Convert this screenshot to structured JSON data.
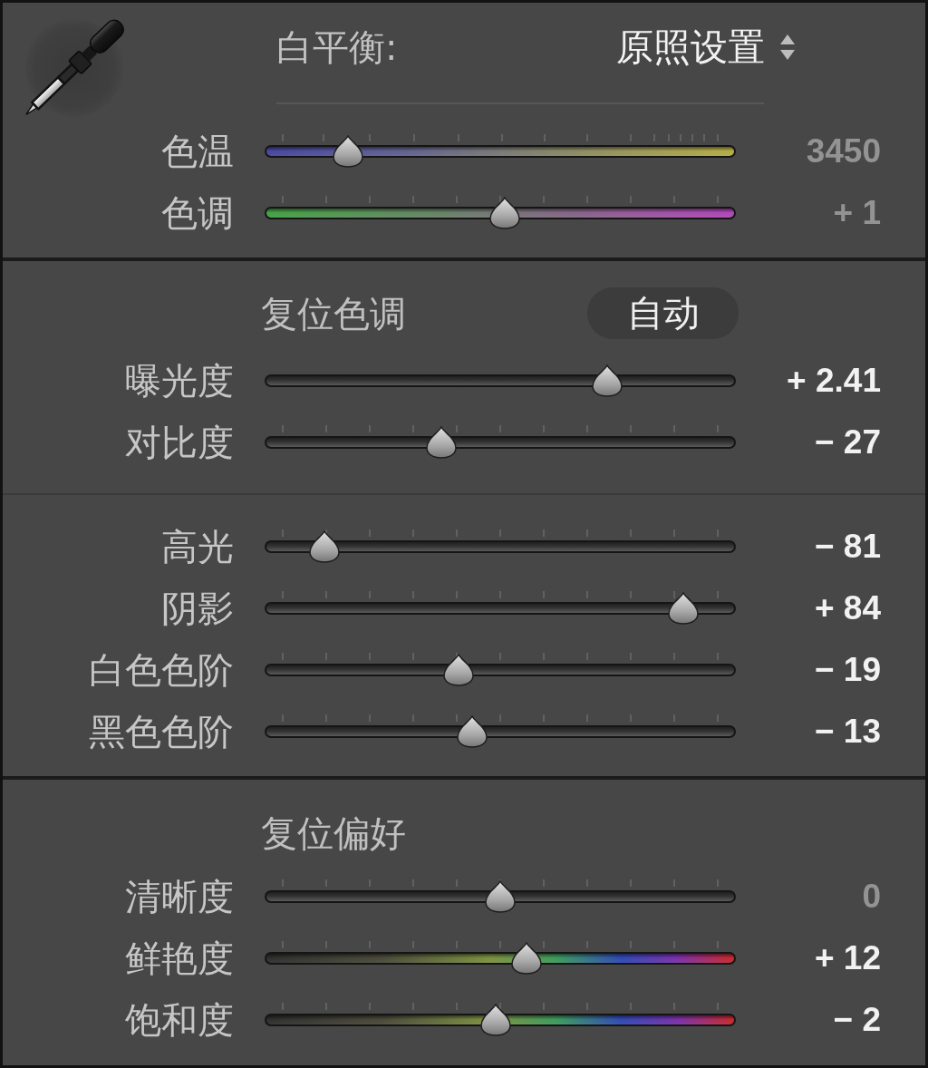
{
  "white_balance": {
    "label": "白平衡:",
    "preset": "原照设置",
    "sliders": [
      {
        "label": "色温",
        "value": "3450",
        "level": 0.15,
        "kind": "temperature",
        "dimmed": true,
        "ticks": true
      },
      {
        "label": "色调",
        "value": "+ 1",
        "level": 0.51,
        "kind": "tint",
        "dimmed": true,
        "ticks": true
      }
    ]
  },
  "tone": {
    "reset_label": "复位色调",
    "auto_button": "自动",
    "sliders": [
      {
        "label": "曝光度",
        "value": "+ 2.41",
        "level": 0.745,
        "kind": "neutral",
        "dimmed": false,
        "ticks": false
      },
      {
        "label": "对比度",
        "value": "− 27",
        "level": 0.365,
        "kind": "neutral",
        "dimmed": false,
        "ticks": true
      }
    ]
  },
  "tone_regions": {
    "sliders": [
      {
        "label": "高光",
        "value": "− 81",
        "level": 0.095,
        "kind": "neutral",
        "dimmed": false,
        "ticks": true
      },
      {
        "label": "阴影",
        "value": "+ 84",
        "level": 0.92,
        "kind": "neutral",
        "dimmed": false,
        "ticks": true
      },
      {
        "label": "白色色阶",
        "value": "− 19",
        "level": 0.405,
        "kind": "neutral",
        "dimmed": false,
        "ticks": true
      },
      {
        "label": "黑色色阶",
        "value": "− 13",
        "level": 0.435,
        "kind": "neutral",
        "dimmed": false,
        "ticks": true
      }
    ]
  },
  "presence": {
    "reset_label": "复位偏好",
    "sliders": [
      {
        "label": "清晰度",
        "value": "0",
        "level": 0.5,
        "kind": "neutral",
        "dimmed": true,
        "ticks": true
      },
      {
        "label": "鲜艳度",
        "value": "+ 12",
        "level": 0.56,
        "kind": "spectrum",
        "dimmed": false,
        "ticks": true
      },
      {
        "label": "饱和度",
        "value": "− 2",
        "level": 0.49,
        "kind": "spectrum",
        "dimmed": false,
        "ticks": true
      }
    ]
  }
}
